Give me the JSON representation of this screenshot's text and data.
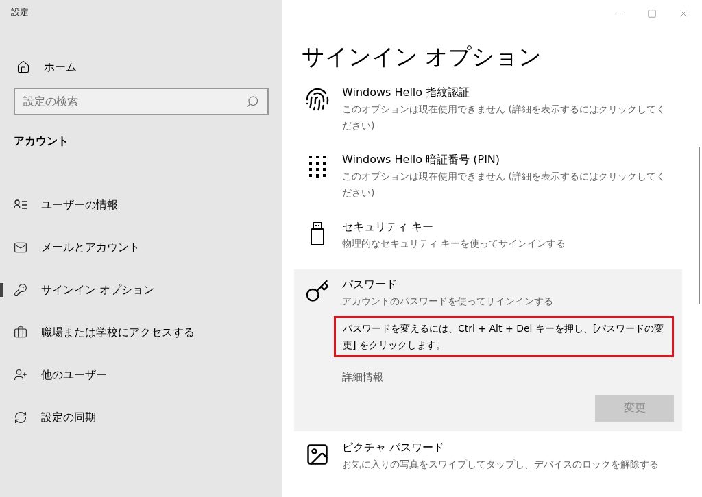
{
  "window": {
    "title": "設定"
  },
  "sidebar": {
    "home": "ホーム",
    "search": {
      "placeholder": "設定の検索"
    },
    "section": "アカウント",
    "items": [
      {
        "kind": "user-info",
        "label": "ユーザーの情報",
        "selected": false
      },
      {
        "kind": "mail",
        "label": "メールとアカウント",
        "selected": false
      },
      {
        "kind": "key",
        "label": "サインイン オプション",
        "selected": true
      },
      {
        "kind": "briefcase",
        "label": "職場または学校にアクセスする",
        "selected": false
      },
      {
        "kind": "user-add",
        "label": "他のユーザー",
        "selected": false
      },
      {
        "kind": "sync",
        "label": "設定の同期",
        "selected": false
      }
    ]
  },
  "main": {
    "title": "サインイン オプション",
    "options": [
      {
        "kind": "fingerprint",
        "title": "Windows Hello 指紋認証",
        "description": "このオプションは現在使用できません (詳細を表示するにはクリックしてください)",
        "expanded": false
      },
      {
        "kind": "pin",
        "title": "Windows Hello 暗証番号 (PIN)",
        "description": "このオプションは現在使用できません (詳細を表示するにはクリックしてください)",
        "expanded": false
      },
      {
        "kind": "usb",
        "title": "セキュリティ キー",
        "description": "物理的なセキュリティ キーを使ってサインインする",
        "expanded": false
      },
      {
        "kind": "password",
        "title": "パスワード",
        "description": "アカウントのパスワードを使ってサインインする",
        "expanded": true,
        "note": "パスワードを変えるには、Ctrl + Alt + Del キーを押し、[パスワードの変更] をクリックします。",
        "note_highlighted": true,
        "link": "詳細情報",
        "button": {
          "label": "変更",
          "disabled": true
        }
      },
      {
        "kind": "picture",
        "title": "ピクチャ パスワード",
        "description": "お気に入りの写真をスワイプしてタップし、デバイスのロックを解除する",
        "expanded": false
      }
    ]
  }
}
